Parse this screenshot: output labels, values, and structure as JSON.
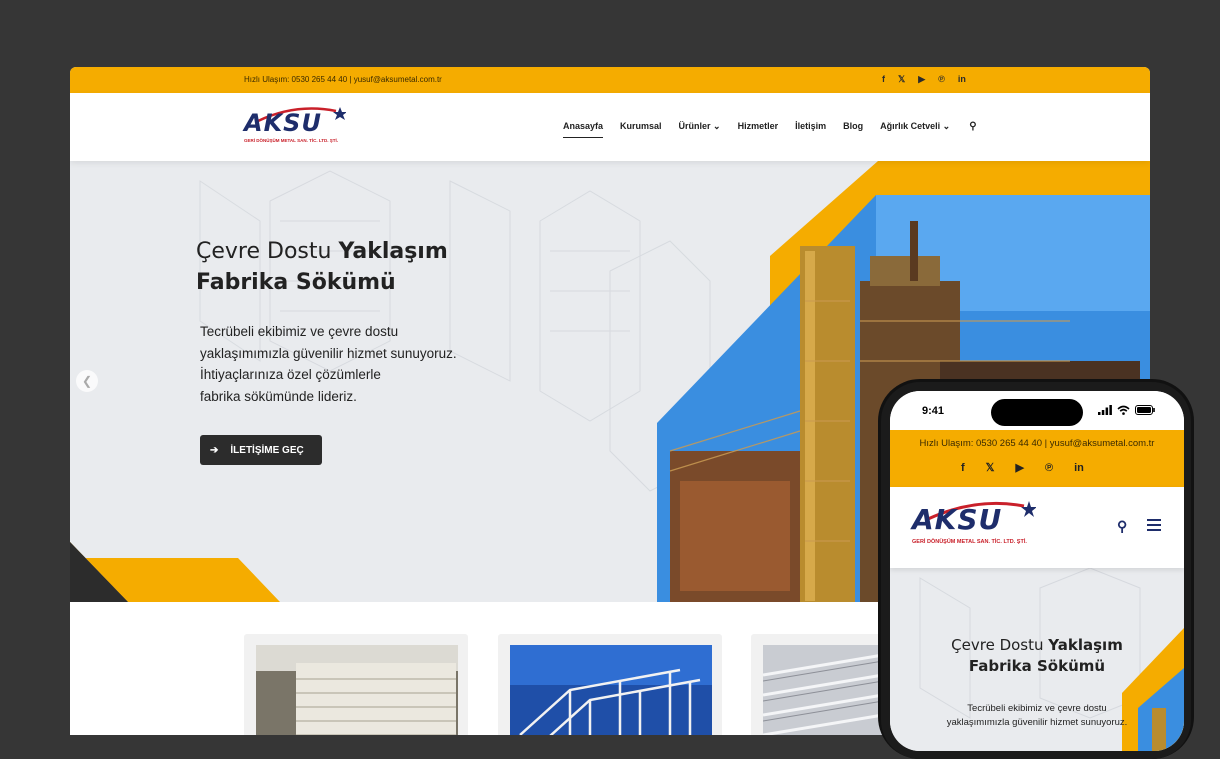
{
  "colors": {
    "accent": "#f5ac00",
    "brand": "#1e2d6b",
    "brand_red": "#c9202a",
    "dark": "#2c2c2c"
  },
  "topbar": {
    "contact": "Hızlı Ulaşım: 0530 265 44 40  |  yusuf@aksumetal.com.tr",
    "socials": [
      "facebook-icon",
      "x-icon",
      "youtube-icon",
      "pinterest-icon",
      "linkedin-icon"
    ]
  },
  "logo": {
    "word": "AKSU",
    "tagline": "GERİ DÖNÜŞÜM METAL SAN. TİC. LTD. ŞTİ."
  },
  "nav": {
    "items": [
      {
        "label": "Anasayfa"
      },
      {
        "label": "Kurumsal"
      },
      {
        "label": "Ürünler ⌄"
      },
      {
        "label": "Hizmetler"
      },
      {
        "label": "İletişim"
      },
      {
        "label": "Blog"
      },
      {
        "label": "Ağırlık Cetveli ⌄"
      }
    ],
    "search_icon": "search-icon"
  },
  "hero": {
    "title_light": "Çevre Dostu ",
    "title_bold": "Yaklaşım",
    "title_line2": "Fabrika Sökümü",
    "desc": [
      "Tecrübeli ekibimiz ve çevre dostu",
      "yaklaşımımızla güvenilir hizmet sunuyoruz.",
      "İhtiyaçlarınıza özel çözümlerle",
      "fabrika sökümünde lideriz."
    ],
    "cta_label": "İLETİŞİME GEÇ"
  },
  "phone": {
    "time": "9:41",
    "contact": "Hızlı Ulaşım: 0530 265 44 40  |  yusuf@aksumetal.com.tr",
    "hero_title_light": "Çevre Dostu ",
    "hero_title_bold": "Yaklaşım",
    "hero_title_line2": "Fabrika Sökümü",
    "hero_desc": [
      "Tecrübeli ekibimiz ve çevre dostu",
      "yaklaşımımızla güvenilir hizmet sunuyoruz."
    ]
  }
}
